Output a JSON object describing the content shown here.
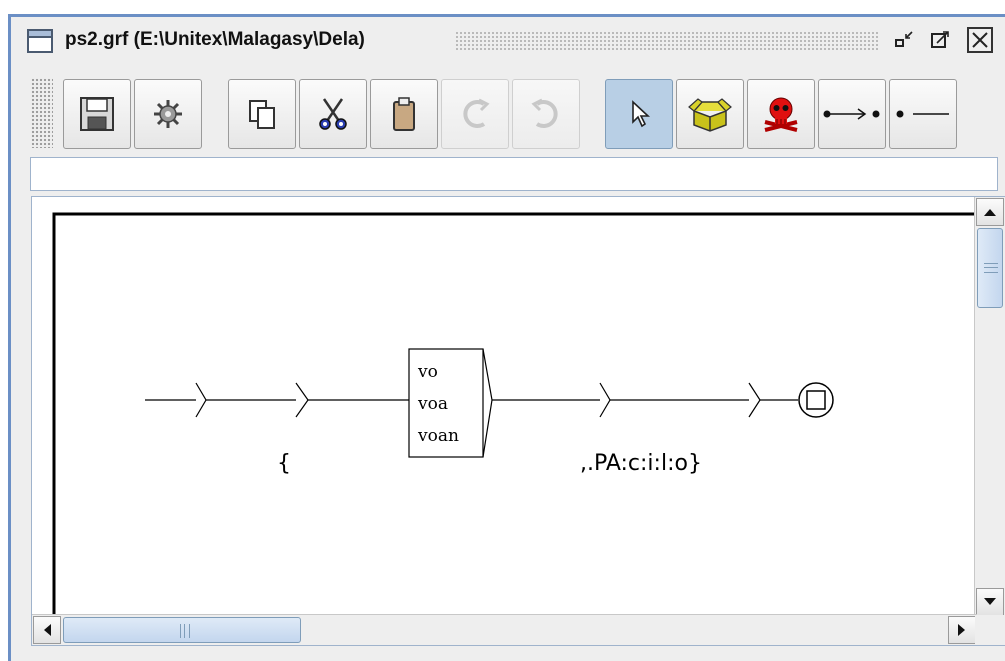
{
  "window": {
    "title": "ps2.grf (E:\\Unitex\\Malagasy\\Dela)",
    "frame_color": "#6b8fc5"
  },
  "toolbar": {
    "buttons": [
      {
        "name": "save",
        "icon": "floppy-disk-icon"
      },
      {
        "name": "compile",
        "icon": "gear-icon"
      },
      {
        "name": "copy",
        "icon": "copy-icon"
      },
      {
        "name": "cut",
        "icon": "scissors-icon"
      },
      {
        "name": "paste",
        "icon": "clipboard-icon"
      },
      {
        "name": "redo",
        "icon": "redo-icon",
        "disabled": true
      },
      {
        "name": "undo",
        "icon": "undo-icon",
        "disabled": true
      },
      {
        "name": "select",
        "icon": "pointer-arrow-icon",
        "selected": true
      },
      {
        "name": "open-subgraph",
        "icon": "open-box-icon"
      },
      {
        "name": "delete",
        "icon": "skull-crossbones-icon"
      },
      {
        "name": "link",
        "icon": "transition-link-icon"
      },
      {
        "name": "reverse-link",
        "icon": "reverse-link-icon"
      }
    ]
  },
  "text_field": {
    "value": ""
  },
  "graph": {
    "box": {
      "lines": [
        "vo",
        "voa",
        "voan"
      ]
    },
    "outputs": [
      "{",
      ",.PA:c:i:l:o}"
    ]
  },
  "colors": {
    "selected_button": "#b8cfe5",
    "scroll_thumb": "#c3d6ee"
  }
}
